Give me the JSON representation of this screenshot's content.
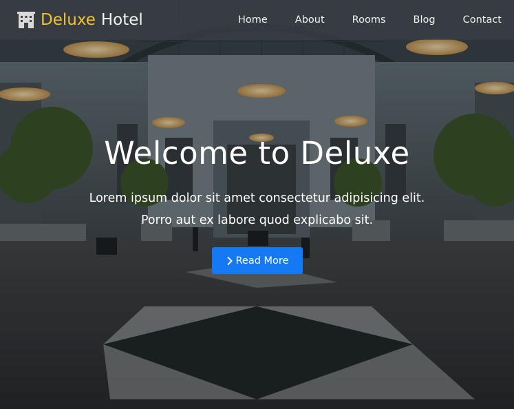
{
  "brand": {
    "name_part1": "Deluxe",
    "name_part2": "Hotel",
    "icon": "hotel-building-icon"
  },
  "nav": {
    "items": [
      "Home",
      "About",
      "Rooms",
      "Blog",
      "Contact"
    ]
  },
  "hero": {
    "title": "Welcome to Deluxe",
    "line1": "Lorem ipsum dolor sit amet consectetur adipisicing elit.",
    "line2": "Porro aut ex labore quod explicabo sit.",
    "button_label": "Read More",
    "button_icon": "chevron-right-icon"
  },
  "colors": {
    "brand_accent": "#f4c22b",
    "button": "#1479f2",
    "navbar": "#3c4046"
  }
}
